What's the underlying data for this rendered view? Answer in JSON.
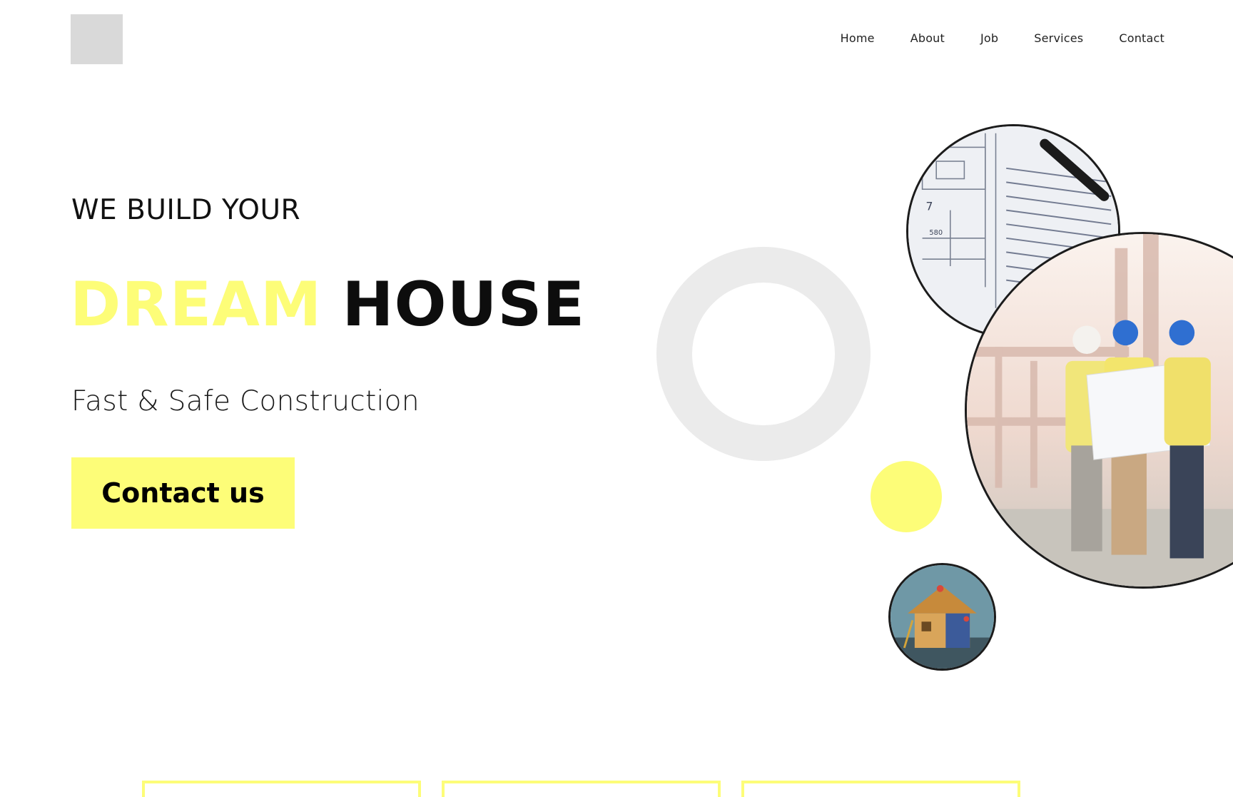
{
  "nav": {
    "items": [
      {
        "label": "Home"
      },
      {
        "label": "About"
      },
      {
        "label": "Job"
      },
      {
        "label": "Services"
      },
      {
        "label": "Contact"
      }
    ]
  },
  "hero": {
    "kicker": "WE BUILD YOUR",
    "title_accent": "DREAM",
    "title_main": "HOUSE",
    "subtitle": "Fast & Safe Construction",
    "cta_label": "Contact us"
  },
  "colors": {
    "accent_yellow": "#fdfd78",
    "ring_gray": "#ebebeb",
    "logo_placeholder": "#d9d9d9",
    "text_dark": "#0d0d0d"
  },
  "images": {
    "blueprint": "blueprint-photo",
    "workers": "construction-workers-photo",
    "house": "house-under-construction-illustration"
  }
}
